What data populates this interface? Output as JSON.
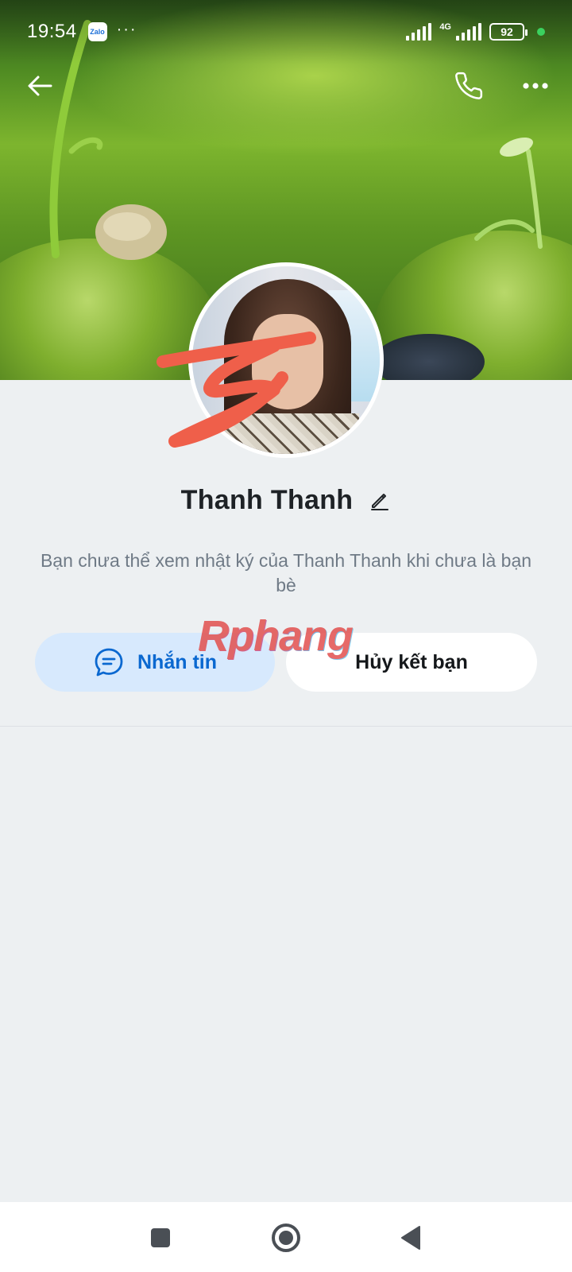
{
  "status_bar": {
    "time": "19:54",
    "app_badge": "Zalo",
    "more_dots": "···",
    "network": "4G",
    "battery": "92",
    "icons": [
      "signal-icon",
      "signal-icon",
      "battery-icon",
      "active-dot"
    ]
  },
  "header": {
    "back_icon": "arrow-left-icon",
    "call_icon": "phone-icon",
    "more_icon": "more-horizontal-icon"
  },
  "profile": {
    "name": "Thanh Thanh",
    "edit_icon": "pencil-icon",
    "notice": "Bạn chưa thể xem nhật ký của Thanh Thanh khi chưa là bạn bè"
  },
  "actions": {
    "message_label": "Nhắn tin",
    "message_icon": "chat-bubble-icon",
    "unfriend_label": "Hủy kết bạn"
  },
  "watermark": "Rphang",
  "nav": {
    "recents_icon": "square-icon",
    "home_icon": "circle-icon",
    "back_icon": "triangle-back-icon"
  },
  "colors": {
    "background": "#EDF0F2",
    "primary_blue": "#0A68D0",
    "message_button_bg": "#D7E9FD"
  }
}
